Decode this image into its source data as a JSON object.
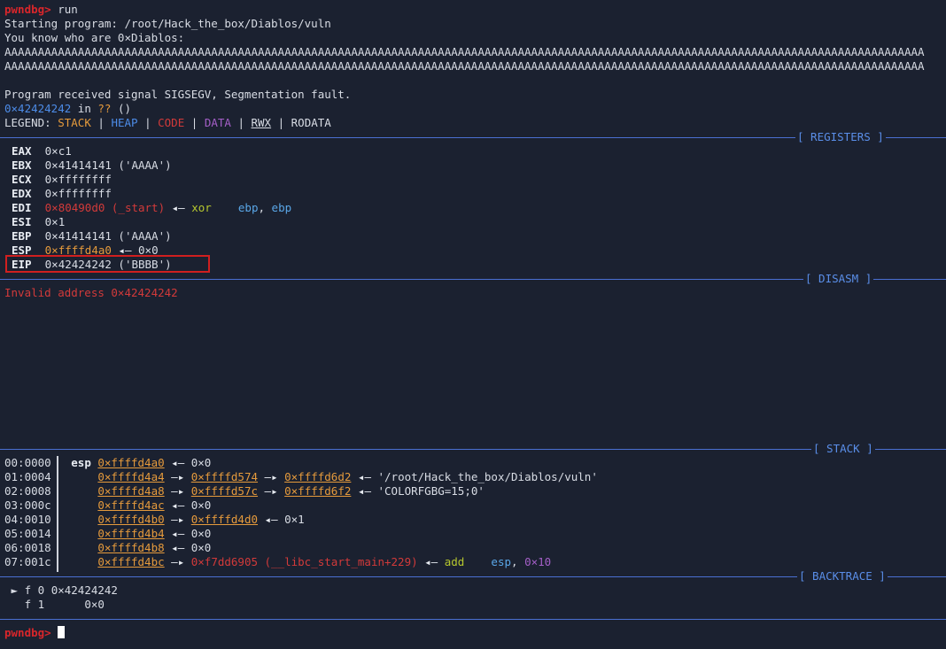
{
  "prompt": "pwndbg>",
  "cmd": "run",
  "starting": "Starting program: /root/Hack_the_box/Diablos/vuln",
  "intro": "You know who are 0×Diablos:",
  "as1": "AAAAAAAAAAAAAAAAAAAAAAAAAAAAAAAAAAAAAAAAAAAAAAAAAAAAAAAAAAAAAAAAAAAAAAAAAAAAAAAAAAAAAAAAAAAAAAAAAAAAAAAAAAAAAAAAAAAAAAAAAAAAAAAAAAAAAAAAAA",
  "as2": "AAAAAAAAAAAAAAAAAAAAAAAAAAAAAAAAAAAAAAAAAAAAAAAAAAAAAAAAAAAAAAAAAAAAAAAAAAAAAAAAAAAAAAAAAAAAAAAAAAAAAAAAAAAAAAAAAAAAAAAAAAAAAAAAAAAAAAAAAA",
  "signal": "Program received signal SIGSEGV, Segmentation fault.",
  "fault": {
    "addr": "0×42424242",
    "in": " in ",
    "sym": "??",
    "paren": " ()"
  },
  "legend": {
    "label": "LEGEND: ",
    "stack": "STACK",
    "heap": "HEAP",
    "code": "CODE",
    "data": "DATA",
    "rwx": "RWX",
    "rodata": "RODATA",
    "bar": " | "
  },
  "sections": {
    "registers": "[ REGISTERS ]",
    "disasm": "[ DISASM ]",
    "stack": "[ STACK ]",
    "backtrace": "[ BACKTRACE ]"
  },
  "registers": {
    "eax": {
      "name": "EAX",
      "val": "0×c1"
    },
    "ebx": {
      "name": "EBX",
      "val": "0×41414141 ('AAAA')"
    },
    "ecx": {
      "name": "ECX",
      "val": "0×ffffffff"
    },
    "edx": {
      "name": "EDX",
      "val": "0×ffffffff"
    },
    "edi": {
      "name": "EDI",
      "val": "0×80490d0 (_start)",
      "arrow": " ◂— ",
      "op": "xor",
      "args1": "ebp",
      "comma": ", ",
      "args2": "ebp"
    },
    "esi": {
      "name": "ESI",
      "val": "0×1"
    },
    "ebp": {
      "name": "EBP",
      "val": "0×41414141 ('AAAA')"
    },
    "esp": {
      "name": "ESP",
      "val": "0×ffffd4a0",
      "arrow": " ◂— ",
      "rest": "0×0"
    },
    "eip": {
      "name": "EIP",
      "val": "0×42424242 ('BBBB')"
    }
  },
  "disasm_msg": "Invalid address 0×42424242",
  "stack": {
    "r0": {
      "off": "00:0000",
      "reg": "esp",
      "addr": "0×ffffd4a0",
      "a1": " ◂— ",
      "v": "0×0"
    },
    "r1": {
      "off": "01:0004",
      "addr": "0×ffffd4a4",
      "a1": " —▸ ",
      "p1": "0×ffffd574",
      "a2": " —▸ ",
      "p2": "0×ffffd6d2",
      "a3": " ◂— ",
      "v": "'/root/Hack_the_box/Diablos/vuln'"
    },
    "r2": {
      "off": "02:0008",
      "addr": "0×ffffd4a8",
      "a1": " —▸ ",
      "p1": "0×ffffd57c",
      "a2": " —▸ ",
      "p2": "0×ffffd6f2",
      "a3": " ◂— ",
      "v": "'COLORFGBG=15;0'"
    },
    "r3": {
      "off": "03:000c",
      "addr": "0×ffffd4ac",
      "a1": " ◂— ",
      "v": "0×0"
    },
    "r4": {
      "off": "04:0010",
      "addr": "0×ffffd4b0",
      "a1": " —▸ ",
      "p1": "0×ffffd4d0",
      "a3": " ◂— ",
      "v": "0×1"
    },
    "r5": {
      "off": "05:0014",
      "addr": "0×ffffd4b4",
      "a1": " ◂— ",
      "v": "0×0"
    },
    "r6": {
      "off": "06:0018",
      "addr": "0×ffffd4b8",
      "a1": " ◂— ",
      "v": "0×0"
    },
    "r7": {
      "off": "07:001c",
      "addr": "0×ffffd4bc",
      "a1": " —▸ ",
      "p1": "0×f7dd6905 (__libc_start_main+229)",
      "a3": " ◂— ",
      "op": "add",
      "args1": "esp",
      "comma": ", ",
      "args2": "0×10"
    }
  },
  "backtrace": {
    "f0": {
      "mark": " ► ",
      "label": "f 0 ",
      "addr": "0×42424242"
    },
    "f1": {
      "mark": "   ",
      "label": "f 1 ",
      "addr": "     0×0"
    }
  }
}
